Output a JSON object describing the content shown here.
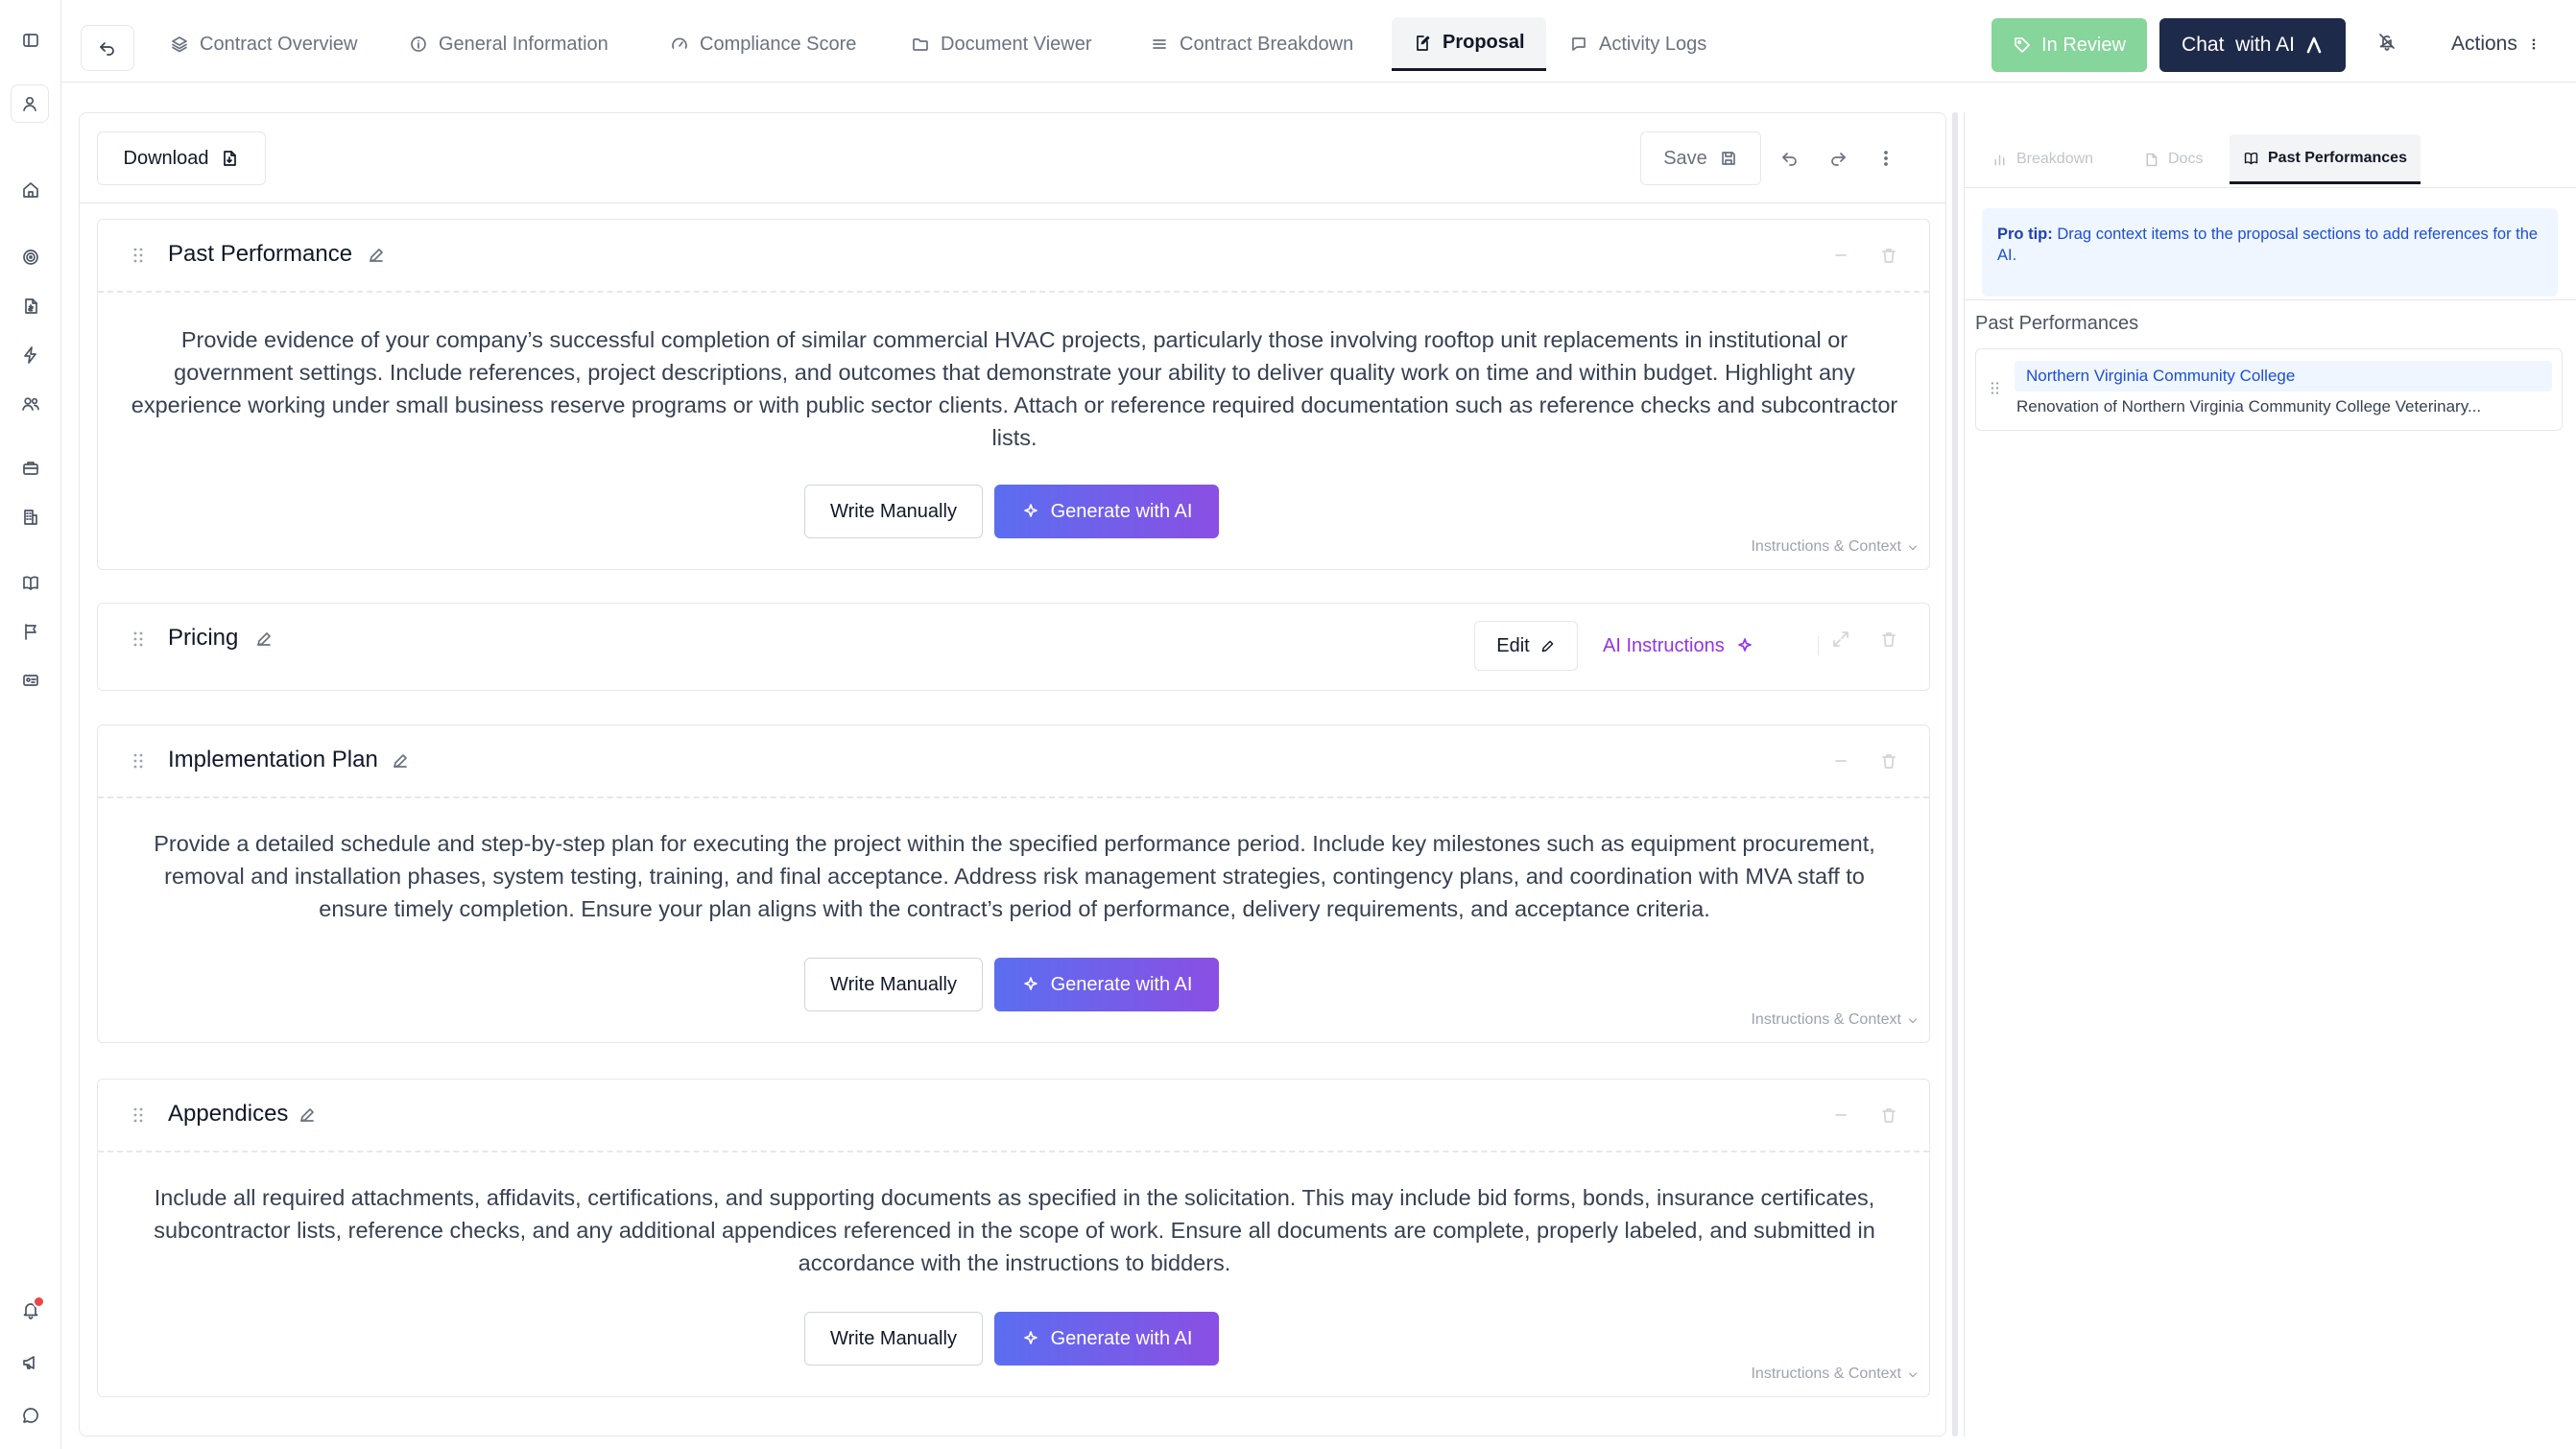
{
  "rail": {
    "icons": [
      "sidebar-toggle-icon",
      "user-icon",
      "home-icon",
      "target-icon",
      "file-dollar-icon",
      "lightning-icon",
      "users-icon",
      "briefcase-icon",
      "building-icon",
      "book-icon",
      "flag-icon",
      "id-card-icon",
      "bell-icon",
      "megaphone-icon",
      "chat-icon"
    ],
    "notification_dot_color": "#ef4444"
  },
  "tabs": [
    {
      "label": "Contract Overview",
      "icon": "layers-icon",
      "active": false
    },
    {
      "label": "General Information",
      "icon": "info-icon",
      "active": false
    },
    {
      "label": "Compliance Score",
      "icon": "gauge-icon",
      "active": false
    },
    {
      "label": "Document Viewer",
      "icon": "folder-icon",
      "active": false
    },
    {
      "label": "Contract Breakdown",
      "icon": "list-icon",
      "active": false
    },
    {
      "label": "Proposal",
      "icon": "edit-doc-icon",
      "active": true
    },
    {
      "label": "Activity Logs",
      "icon": "message-icon",
      "active": false
    }
  ],
  "header": {
    "status_label": "In Review",
    "status_color": "#86d59a",
    "chat_label": "Chat  with AI",
    "chat_color": "#1e2a4a",
    "actions_label": "Actions"
  },
  "toolbar": {
    "download_label": "Download",
    "save_label": "Save"
  },
  "sections": [
    {
      "title": "Past Performance",
      "body": "Provide evidence of your company’s successful completion of similar commercial HVAC projects, particularly those involving rooftop unit replacements in institutional or government settings. Include references, project descriptions, and outcomes that demonstrate your ability to deliver quality work on time and within budget. Highlight any experience working under small business reserve programs or with public sector clients. Attach or reference required documentation such as reference checks and subcontractor lists.",
      "write_label": "Write Manually",
      "generate_label": "Generate with AI",
      "instructions_label": "Instructions & Context"
    },
    {
      "title": "Pricing",
      "edit_label": "Edit",
      "ai_instructions_label": "AI Instructions"
    },
    {
      "title": "Implementation Plan",
      "body": "Provide a detailed schedule and step-by-step plan for executing the project within the specified performance period. Include key milestones such as equipment procurement, removal and installation phases, system testing, training, and final acceptance. Address risk management strategies, contingency plans, and coordination with MVA staff to ensure timely completion. Ensure your plan aligns with the contract’s period of performance, delivery requirements, and acceptance criteria.",
      "write_label": "Write Manually",
      "generate_label": "Generate with AI",
      "instructions_label": "Instructions & Context"
    },
    {
      "title": "Appendices",
      "body": "Include all required attachments, affidavits, certifications, and supporting documents as specified in the solicitation. This may include bid forms, bonds, insurance certificates, subcontractor lists, reference checks, and any additional appendices referenced in the scope of work. Ensure all documents are complete, properly labeled, and submitted in accordance with the instructions to bidders.",
      "write_label": "Write Manually",
      "generate_label": "Generate with AI",
      "instructions_label": "Instructions & Context"
    }
  ],
  "right_panel": {
    "tabs": [
      {
        "label": "Breakdown",
        "active": false
      },
      {
        "label": "Docs",
        "active": false
      },
      {
        "label": "Past Performances",
        "active": true
      }
    ],
    "protip_label": "Pro tip:",
    "protip_text": "Drag context items to the proposal sections to add references for the AI.",
    "list_label": "Past Performances",
    "items": [
      {
        "title": "Northern Virginia Community College",
        "description": "Renovation of Northern Virginia Community College Veterinary..."
      }
    ]
  }
}
